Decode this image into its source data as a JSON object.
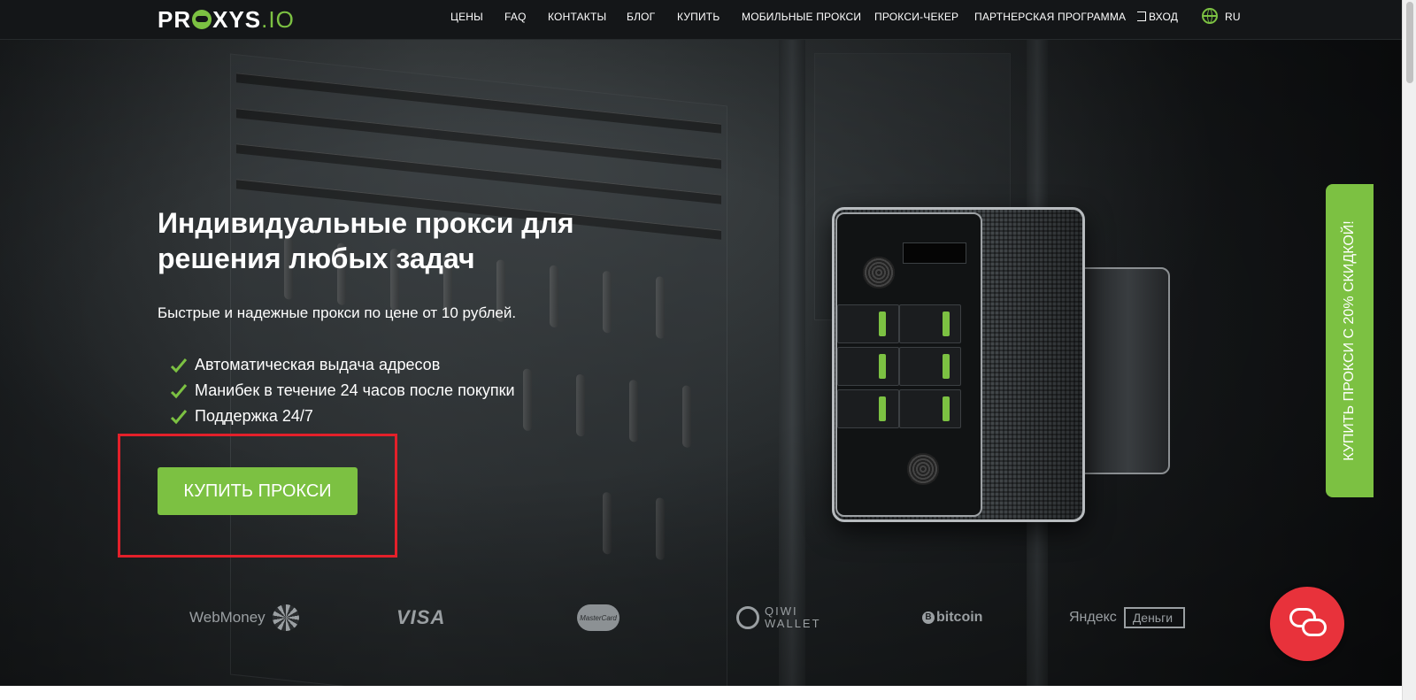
{
  "brand": {
    "name": "PR",
    "name_rest": "XYS",
    "suffix": ".IO"
  },
  "nav": {
    "items": [
      {
        "label": "ЦЕНЫ"
      },
      {
        "label": "FAQ"
      },
      {
        "label": "КОНТАКТЫ"
      },
      {
        "label": "БЛОГ"
      },
      {
        "label": "КУПИТЬ"
      },
      {
        "label": "МОБИЛЬНЫЕ ПРОКСИ"
      },
      {
        "label": "ПРОКСИ-ЧЕКЕР"
      },
      {
        "label": "ПАРТНЕРСКАЯ ПРОГРАММА"
      },
      {
        "label": "ВХОД"
      }
    ],
    "language": "RU"
  },
  "hero": {
    "title": "Индивидуальные прокси для решения любых задач",
    "subtitle": "Быстрые и надежные прокси по цене от 10 рублей.",
    "features": [
      "Автоматическая выдача адресов",
      "Манибек в течение 24 часов после покупки",
      "Поддержка 24/7"
    ],
    "cta_label": "КУПИТЬ ПРОКСИ"
  },
  "payments": {
    "webmoney": "WebMoney",
    "visa": "VISA",
    "mastercard": "MasterCard",
    "qiwi_line1": "QIWI",
    "qiwi_line2": "WALLET",
    "bitcoin_symbol": "B",
    "bitcoin": "bitcoin",
    "yandex": "Яндекс",
    "yandex_money": "Деньги"
  },
  "side_tab": {
    "label": "КУПИТЬ ПРОКСИ С 20% СКИДКОЙ!"
  },
  "colors": {
    "accent": "#7cc142",
    "highlight": "#e3202a",
    "chat": "#e8323b"
  },
  "icons": {
    "login": "login-icon",
    "language": "globe-icon",
    "feature": "check-icon",
    "chat": "chat-icon"
  }
}
